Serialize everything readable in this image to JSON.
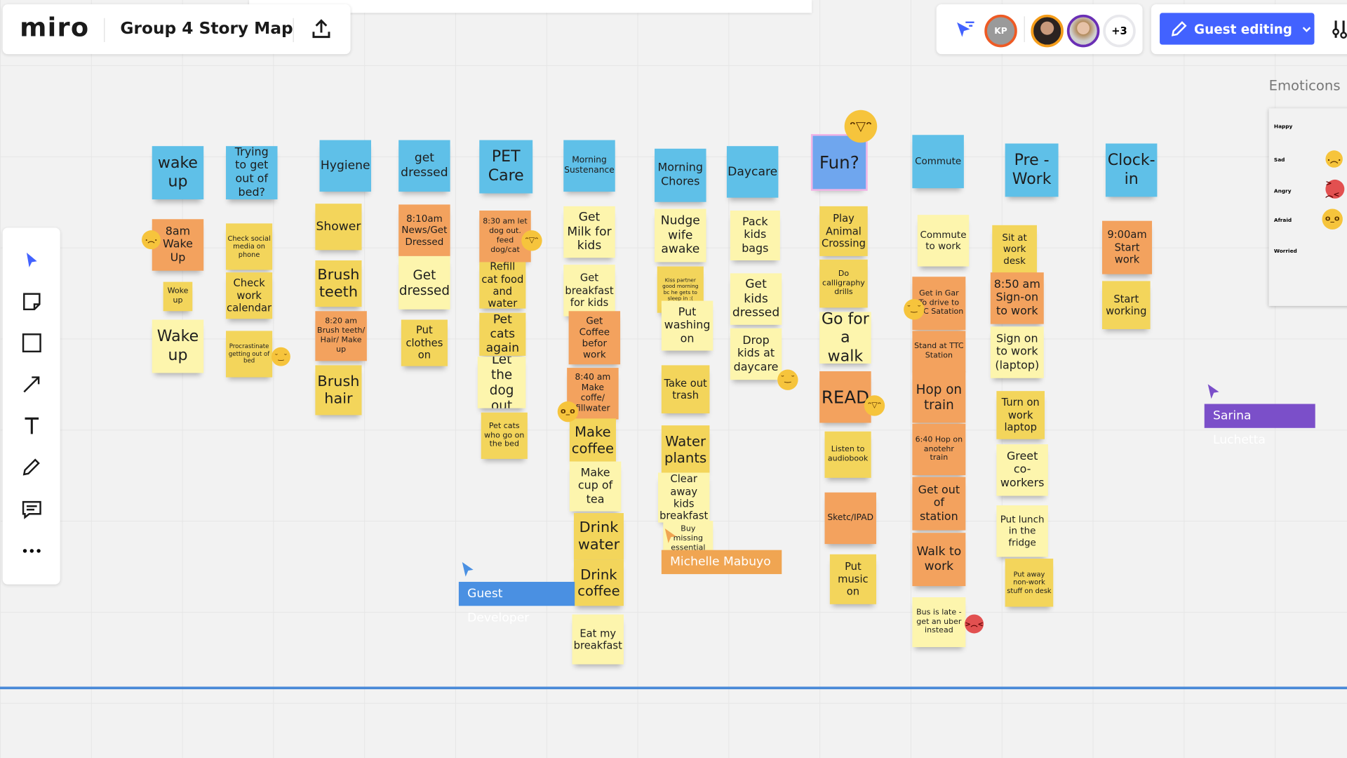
{
  "app": {
    "logo": "miro",
    "board_title": "Group 4 Story Map",
    "share_icon": "upload-icon"
  },
  "collaborators": {
    "initials": "KP",
    "more_count": "+3",
    "guest_button": "Guest editing"
  },
  "colors": {
    "blue": "#5fc0e8",
    "orange": "#f3a25e",
    "yellow": "#f3d55b",
    "light": "#fdf5ad",
    "accent": "#4262ff",
    "timeline": "#4a8ad8"
  },
  "toolbar": [
    "select",
    "sticky-note",
    "rectangle",
    "arrow",
    "text",
    "pen",
    "comment",
    "more"
  ],
  "emoticons": {
    "title": "Emoticons",
    "rows": [
      "Happy",
      "Sad",
      "Angry",
      "Afraid",
      "Worried"
    ]
  },
  "notes": [
    {
      "t": "wake up",
      "c": "blue"
    },
    {
      "t": "Trying to get out of bed?",
      "c": "blue"
    },
    {
      "t": "Hygiene",
      "c": "blue"
    },
    {
      "t": "get dressed",
      "c": "blue"
    },
    {
      "t": "PET Care",
      "c": "blue"
    },
    {
      "t": "Morning Sustenance",
      "c": "blue"
    },
    {
      "t": "Morning Chores",
      "c": "blue"
    },
    {
      "t": "Daycare",
      "c": "blue"
    },
    {
      "t": "Fun?",
      "c": "fun"
    },
    {
      "t": "Commute",
      "c": "blue"
    },
    {
      "t": "Pre - Work",
      "c": "blue"
    },
    {
      "t": "Clock-in",
      "c": "blue"
    },
    {
      "t": "8am Wake Up",
      "c": "orange"
    },
    {
      "t": "Woke up",
      "c": "yellow"
    },
    {
      "t": "Wake up",
      "c": "light"
    },
    {
      "t": "Check social media on phone",
      "c": "yellow"
    },
    {
      "t": "Check work calendar",
      "c": "yellow"
    },
    {
      "t": "Procrastinate getting out of bed",
      "c": "yellow"
    },
    {
      "t": "Shower",
      "c": "yellow"
    },
    {
      "t": "Brush teeth",
      "c": "yellow"
    },
    {
      "t": "8:20 am Brush teeth/ Hair/ Make up",
      "c": "orange"
    },
    {
      "t": "Brush hair",
      "c": "yellow"
    },
    {
      "t": "8:10am News/Get Dressed",
      "c": "orange"
    },
    {
      "t": "Get dressed",
      "c": "light"
    },
    {
      "t": "Put clothes on",
      "c": "yellow"
    },
    {
      "t": "8:30 am let dog out. feed dog/cat",
      "c": "orange"
    },
    {
      "t": "Refill cat food and water",
      "c": "yellow"
    },
    {
      "t": "Pet cats again",
      "c": "yellow"
    },
    {
      "t": "Let the dog out",
      "c": "light"
    },
    {
      "t": "Pet cats who go on the bed",
      "c": "yellow"
    },
    {
      "t": "Get Milk for kids",
      "c": "light"
    },
    {
      "t": "Get breakfast for kids",
      "c": "light"
    },
    {
      "t": "Get Coffee befor work",
      "c": "orange"
    },
    {
      "t": "8:40 am Make coffe/ fillwater",
      "c": "orange"
    },
    {
      "t": "Make coffee",
      "c": "yellow"
    },
    {
      "t": "Make cup of tea",
      "c": "light"
    },
    {
      "t": "Drink water",
      "c": "yellow"
    },
    {
      "t": "Drink coffee",
      "c": "yellow"
    },
    {
      "t": "Eat my breakfast",
      "c": "light"
    },
    {
      "t": "Nudge wife awake",
      "c": "light"
    },
    {
      "t": "Kiss partner good morning bc he gets to sleep in :(",
      "c": "yellow"
    },
    {
      "t": "Put washing on",
      "c": "light"
    },
    {
      "t": "Take out trash",
      "c": "yellow"
    },
    {
      "t": "Water plants",
      "c": "yellow"
    },
    {
      "t": "Clear away kids breakfast",
      "c": "light"
    },
    {
      "t": "Buy missing essential groceries",
      "c": "light"
    },
    {
      "t": "Pack kids bags",
      "c": "light"
    },
    {
      "t": "Get kids dressed",
      "c": "light"
    },
    {
      "t": "Drop kids at daycare",
      "c": "light"
    },
    {
      "t": "Play Animal Crossing",
      "c": "yellow"
    },
    {
      "t": "Do calligraphy drills",
      "c": "yellow"
    },
    {
      "t": "Go for a walk",
      "c": "light"
    },
    {
      "t": "READ",
      "c": "orange"
    },
    {
      "t": "Listen to audiobook",
      "c": "yellow"
    },
    {
      "t": "Sketc/IPAD",
      "c": "orange"
    },
    {
      "t": "Put music on",
      "c": "yellow"
    },
    {
      "t": "Commute to work",
      "c": "light"
    },
    {
      "t": "Get in Gar To drive to TTC Satation",
      "c": "orange"
    },
    {
      "t": "Stand at TTC Station",
      "c": "orange"
    },
    {
      "t": "Hop on train",
      "c": "orange"
    },
    {
      "t": "6:40 Hop on anotehr train",
      "c": "orange"
    },
    {
      "t": "Get out of station",
      "c": "orange"
    },
    {
      "t": "Walk to work",
      "c": "orange"
    },
    {
      "t": "Bus is late - get an uber instead",
      "c": "light"
    },
    {
      "t": "Sit at work desk",
      "c": "yellow"
    },
    {
      "t": "8:50 am Sign-on to work",
      "c": "orange"
    },
    {
      "t": "Sign on to work (laptop)",
      "c": "light"
    },
    {
      "t": "Turn on work laptop",
      "c": "yellow"
    },
    {
      "t": "Greet co-workers",
      "c": "light"
    },
    {
      "t": "Put lunch in the fridge",
      "c": "light"
    },
    {
      "t": "Put away non-work stuff on desk",
      "c": "yellow"
    },
    {
      "t": "9:00am Start work",
      "c": "orange"
    },
    {
      "t": "Start working",
      "c": "yellow"
    }
  ],
  "reactions": [
    "sad",
    "content",
    "grin",
    "big-grin",
    "content",
    "grin",
    "afraid",
    "content",
    "angry"
  ],
  "cursors": [
    {
      "name": "Guest Developer",
      "color": "#4a90e2"
    },
    {
      "name": "Michelle Mabuyo",
      "color": "#f0a552"
    },
    {
      "name": "Sarina Luchetta",
      "color": "#7b4fc9"
    }
  ]
}
